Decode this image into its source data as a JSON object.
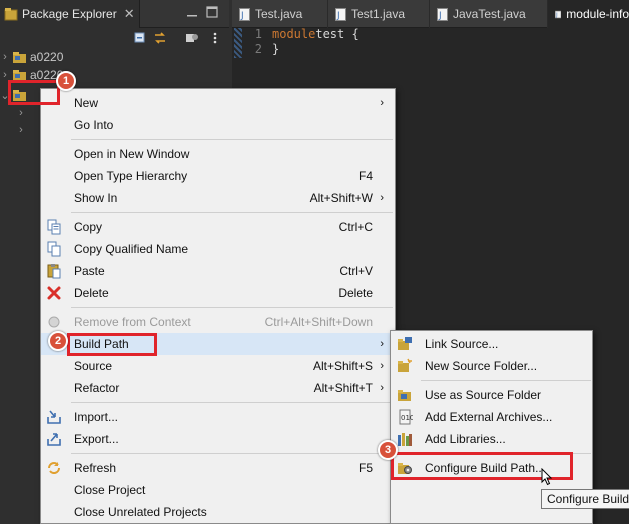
{
  "package_explorer": {
    "tab_title": "Package Explorer",
    "tree": [
      "a0220",
      "a0220"
    ]
  },
  "editor": {
    "tabs": [
      "Test.java",
      "Test1.java",
      "JavaTest.java",
      "module-info"
    ],
    "code": [
      {
        "num": "1",
        "kw": "module",
        "text": " test {"
      },
      {
        "num": "2",
        "kw": "",
        "text": "}"
      }
    ]
  },
  "context_menu": {
    "new": "New",
    "go_into": "Go Into",
    "open_new_window": "Open in New Window",
    "open_type_hierarchy": "Open Type Hierarchy",
    "open_type_hierarchy_sc": "F4",
    "show_in": "Show In",
    "show_in_sc": "Alt+Shift+W",
    "copy": "Copy",
    "copy_sc": "Ctrl+C",
    "copy_qualified": "Copy Qualified Name",
    "paste": "Paste",
    "paste_sc": "Ctrl+V",
    "delete": "Delete",
    "delete_sc": "Delete",
    "remove_context": "Remove from Context",
    "remove_context_sc": "Ctrl+Alt+Shift+Down",
    "build_path": "Build Path",
    "source": "Source",
    "source_sc": "Alt+Shift+S",
    "refactor": "Refactor",
    "refactor_sc": "Alt+Shift+T",
    "import": "Import...",
    "export": "Export...",
    "refresh": "Refresh",
    "refresh_sc": "F5",
    "close_project": "Close Project",
    "close_unrelated": "Close Unrelated Projects",
    "arrow": "›"
  },
  "build_path_submenu": {
    "link_source": "Link Source...",
    "new_source_folder": "New Source Folder...",
    "use_as_source": "Use as Source Folder",
    "add_external_archives": "Add External Archives...",
    "add_libraries": "Add Libraries...",
    "configure_build_path": "Configure Build Path..."
  },
  "tooltip": "Configure Build Path...",
  "steps": [
    "1",
    "2",
    "3"
  ],
  "colors": {
    "callout_red": "#e0242b",
    "badge": "#d8513a",
    "keyword": "#cc7832"
  }
}
